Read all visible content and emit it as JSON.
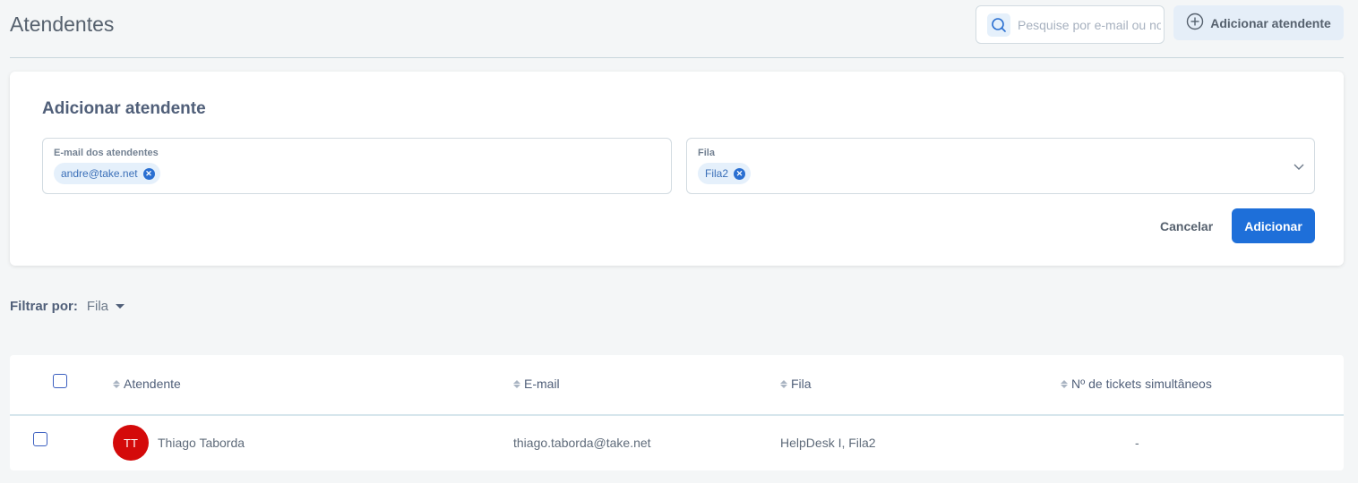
{
  "header": {
    "title": "Atendentes",
    "search_placeholder": "Pesquise por e-mail ou nome",
    "add_button_label": "Adicionar atendente"
  },
  "add_form": {
    "title": "Adicionar atendente",
    "email_field_label": "E-mail dos atendentes",
    "email_chips": [
      "andre@take.net"
    ],
    "fila_field_label": "Fila",
    "fila_chips": [
      "Fila2"
    ],
    "cancel_label": "Cancelar",
    "submit_label": "Adicionar"
  },
  "filter": {
    "label": "Filtrar por:",
    "value": "Fila"
  },
  "table": {
    "columns": [
      "Atendente",
      "E-mail",
      "Fila",
      "Nº de tickets simultâneos"
    ],
    "rows": [
      {
        "initials": "TT",
        "name": "Thiago Taborda",
        "email": "thiago.taborda@take.net",
        "fila": "HelpDesk I, Fila2",
        "tickets": "-",
        "avatar_color": "#d40a0a"
      }
    ]
  },
  "colors": {
    "primary": "#1e6fd9",
    "chip_bg": "#e5f0fb",
    "avatar": "#d40a0a"
  }
}
